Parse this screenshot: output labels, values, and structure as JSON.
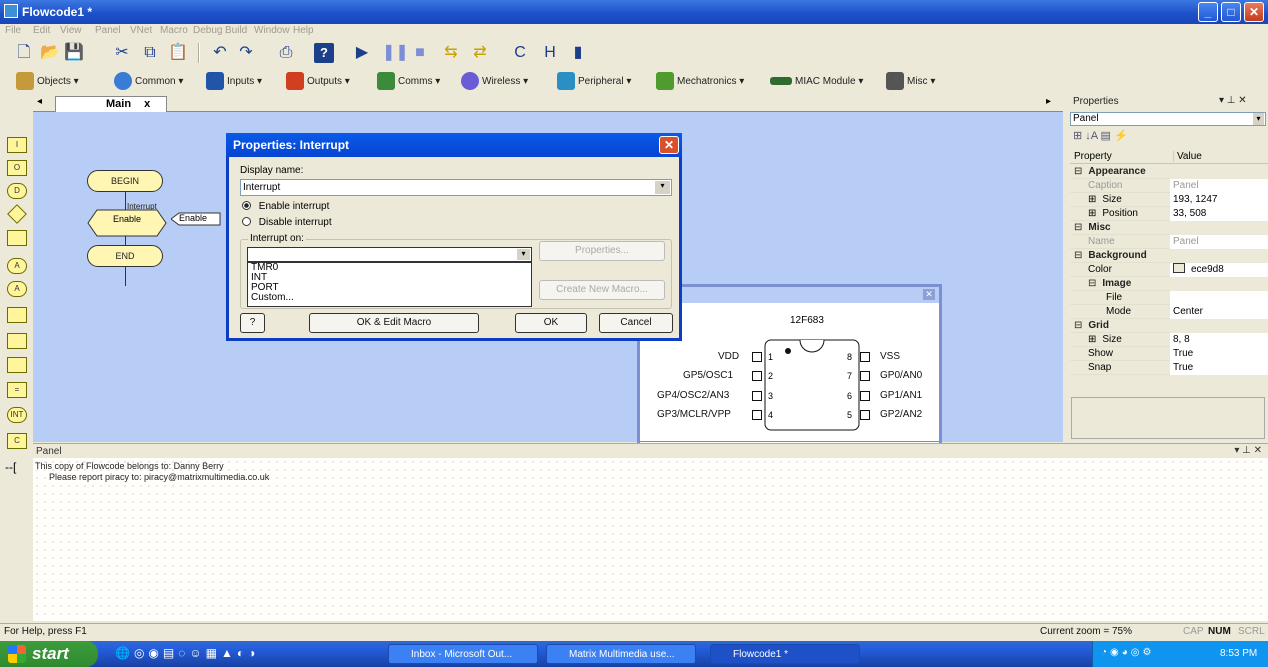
{
  "window": {
    "title": "Flowcode1 *",
    "min": "_",
    "max": "□",
    "close": "✕"
  },
  "menu": [
    "File",
    "Edit",
    "View",
    "Panel",
    "VNet",
    "Macro",
    "Debug",
    "Build",
    "Window",
    "Help"
  ],
  "component_toolbar": [
    "Objects",
    "Common",
    "Inputs",
    "Outputs",
    "Comms",
    "Wireless",
    "Peripheral",
    "Mechatronics",
    "MIAC Module",
    "Misc"
  ],
  "tab": {
    "label": "Main",
    "close": "x"
  },
  "flowchart": {
    "begin": "BEGIN",
    "interrupt_label": "Interrupt",
    "enable": "Enable",
    "enable_tag": "Enable",
    "end": "END"
  },
  "palette_labels": [
    "I",
    "O",
    "D",
    "",
    "",
    "A",
    "A",
    "",
    "",
    "",
    "",
    "INT",
    "C"
  ],
  "dialog": {
    "title": "Properties: Interrupt",
    "display_name_label": "Display name:",
    "display_name_value": "Interrupt",
    "radio_enable": "Enable interrupt",
    "radio_disable": "Disable interrupt",
    "interrupt_on_label": "Interrupt on:",
    "interrupt_on_value": "",
    "options": [
      "TMR0",
      "INT",
      "PORT",
      "Custom..."
    ],
    "properties_button": "Properties...",
    "create_macro_button": "Create New Macro...",
    "help_button": "?",
    "ok_edit_button": "OK & Edit Macro",
    "ok_button": "OK",
    "cancel_button": "Cancel"
  },
  "chip": {
    "name": "12F683",
    "left_pins": [
      {
        "num": "1",
        "label": "VDD"
      },
      {
        "num": "2",
        "label": "GP5/OSC1"
      },
      {
        "num": "3",
        "label": "GP4/OSC2/AN3"
      },
      {
        "num": "4",
        "label": "GP3/MCLR/VPP"
      }
    ],
    "right_pins": [
      {
        "num": "8",
        "label": "VSS"
      },
      {
        "num": "7",
        "label": "GP0/AN0"
      },
      {
        "num": "6",
        "label": "GP1/AN1"
      },
      {
        "num": "5",
        "label": "GP2/AN2"
      }
    ]
  },
  "properties": {
    "header": "Properties",
    "selected": "Panel",
    "col_property": "Property",
    "col_value": "Value",
    "rows": [
      {
        "k": "Appearance",
        "v": "",
        "type": "cat",
        "sym": "⊟"
      },
      {
        "k": "Caption",
        "v": "Panel",
        "type": "gray"
      },
      {
        "k": "Size",
        "v": "193, 1247",
        "type": "sub",
        "sym": "⊞"
      },
      {
        "k": "Position",
        "v": "33, 508",
        "type": "sub",
        "sym": "⊞"
      },
      {
        "k": "Misc",
        "v": "",
        "type": "cat",
        "sym": "⊟"
      },
      {
        "k": "Name",
        "v": "Panel",
        "type": "gray"
      },
      {
        "k": "Background",
        "v": "",
        "type": "cat",
        "sym": "⊟"
      },
      {
        "k": "Color",
        "v": "ece9d8",
        "type": "color"
      },
      {
        "k": "Image",
        "v": "",
        "type": "cat",
        "sym": "⊟"
      },
      {
        "k": "File",
        "v": "",
        "type": "deep"
      },
      {
        "k": "Mode",
        "v": "Center",
        "type": "deep"
      },
      {
        "k": "Grid",
        "v": "",
        "type": "cat",
        "sym": "⊟"
      },
      {
        "k": "Size",
        "v": "8, 8",
        "type": "sub",
        "sym": "⊞"
      },
      {
        "k": "Show",
        "v": "True",
        "type": "plain"
      },
      {
        "k": "Snap",
        "v": "True",
        "type": "plain"
      }
    ]
  },
  "panel": {
    "title": "Panel",
    "line1": "This copy of Flowcode belongs to: Danny Berry",
    "line2": "Please report piracy to: piracy@matrixmultimedia.co.uk"
  },
  "status": {
    "help": "For Help, press F1",
    "zoom": "Current zoom = 75%",
    "cap": "CAP",
    "num": "NUM",
    "scrl": "SCRL"
  },
  "taskbar": {
    "start": "start",
    "tasks": [
      "Inbox - Microsoft Out...",
      "Matrix Multimedia use...",
      "Flowcode1 *"
    ],
    "clock": "8:53 PM"
  },
  "colors": {
    "canvas": "#b8cdf5",
    "titlebar": "#0a5ae8",
    "panel_bg": "#ece9d8"
  }
}
